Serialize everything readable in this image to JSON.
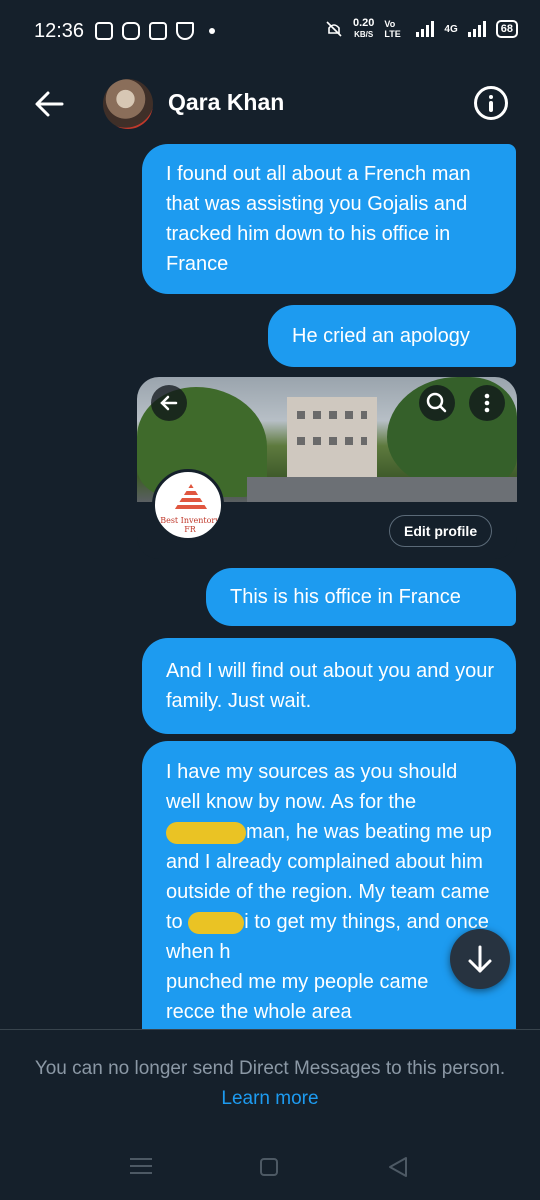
{
  "status_bar": {
    "time": "12:36",
    "speed": "0.20",
    "speed_unit": "KB/S",
    "volte": "Vo LTE",
    "network": "4G",
    "battery": "68"
  },
  "header": {
    "contact_name": "Qara Khan",
    "back_icon": "arrow-left-icon",
    "info_icon": "info-icon"
  },
  "messages": [
    {
      "text": "I found out all about a French man that was assisting you Gojalis and tracked him down to his office in France"
    },
    {
      "text": "He cried an apology"
    },
    {
      "text": "This is his office in France"
    },
    {
      "text": "And I will find out about you and your family. Just wait."
    }
  ],
  "last_message": {
    "part1": "I have my sources as you should well know by now. As for the ",
    "part2": "man, he was beating me up and I already complained about him outside of the region. My team came to ",
    "part3": "i to get my things, and once when h",
    "part4": "punched me my people came",
    "part5": "recce the whole area"
  },
  "shared_card": {
    "edit_profile_label": "Edit profile",
    "logo_text": "Best Inventory FR"
  },
  "notice": {
    "text": "You can no longer send Direct Messages to this person.",
    "link": "Learn more"
  },
  "colors": {
    "background": "#15202b",
    "bubble": "#1d9bf0",
    "muted_text": "#8b98a5",
    "link": "#1d9bf0"
  }
}
